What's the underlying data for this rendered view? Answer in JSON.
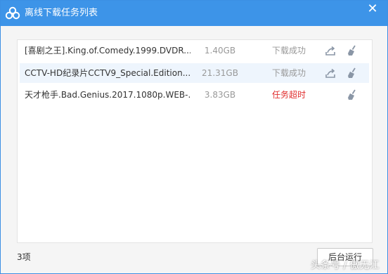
{
  "window": {
    "title": "离线下载任务列表",
    "close_glyph": "✕",
    "logo_icon": "baidu-cloud-icon",
    "accent": "#3d94e8"
  },
  "tasks": [
    {
      "name": "[喜剧之王].King.of.Comedy.1999.DVDR...",
      "size": "1.40GB",
      "status": "下载成功",
      "state": "success",
      "actions": [
        "share-icon",
        "broom-icon"
      ]
    },
    {
      "name": "CCTV-HD纪录片CCTV9_Special.Edition...",
      "size": "21.31GB",
      "status": "下载成功",
      "state": "success",
      "actions": [
        "share-icon",
        "broom-icon"
      ]
    },
    {
      "name": "天才枪手.Bad.Genius.2017.1080p.WEB-...",
      "size": "3.83GB",
      "status": "任务超时",
      "state": "error",
      "actions": [
        "broom-icon"
      ]
    }
  ],
  "footer": {
    "count": "3项",
    "background_button": "后台运行"
  },
  "watermark": "头条号 / 傲无江",
  "colors": {
    "success_text": "#999999",
    "error_text": "#e02d2d",
    "row_highlight": "#eef5fd"
  }
}
